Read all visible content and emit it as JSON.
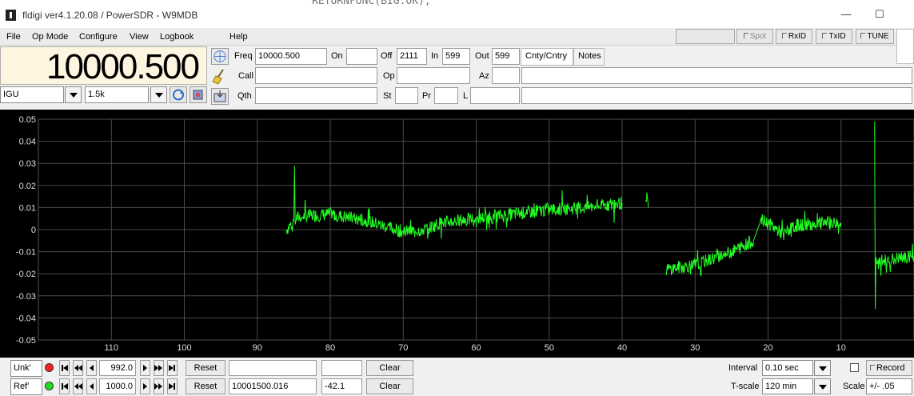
{
  "window": {
    "title": "fldigi ver4.1.20.08 / PowerSDR - W9MDB",
    "background_text": "RETURNFUNC(BIG.OK);",
    "minimize": "—",
    "maximize": "☐"
  },
  "menu": {
    "file": "File",
    "op_mode": "Op Mode",
    "configure": "Configure",
    "view": "View",
    "logbook": "Logbook",
    "help": "Help"
  },
  "toolbar": {
    "spot": "Spot",
    "rxid": "RxID",
    "txid": "TxID",
    "tune": "TUNE"
  },
  "freq_display": "10000.500",
  "mode": {
    "sideband": "IGU",
    "bandwidth": "1.5k"
  },
  "log": {
    "freq_label": "Freq",
    "freq_value": "10000.500",
    "on_label": "On",
    "on_value": "",
    "off_label": "Off",
    "off_value": "2111",
    "in_label": "In",
    "in_value": "599",
    "out_label": "Out",
    "out_value": "599",
    "tab_cnty": "Cnty/Cntry",
    "tab_notes": "Notes",
    "call_label": "Call",
    "call_value": "",
    "op_label": "Op",
    "op_value": "",
    "az_label": "Az",
    "az_value": "",
    "qth_label": "Qth",
    "qth_value": "",
    "st_label": "St",
    "st_value": "",
    "pr_label": "Pr",
    "pr_value": "",
    "l_label": "L",
    "l_value": ""
  },
  "chart_data": {
    "type": "line",
    "ylim": [
      -0.05,
      0.05
    ],
    "yticks": [
      "0.05",
      "0.04",
      "0.03",
      "0.02",
      "0.01",
      "0",
      "-0.01",
      "-0.02",
      "-0.03",
      "-0.04",
      "-0.05"
    ],
    "xlim": [
      120,
      0
    ],
    "xticks": [
      "110",
      "100",
      "90",
      "80",
      "70",
      "60",
      "50",
      "40",
      "30",
      "20",
      "10"
    ],
    "xtick_values": [
      110,
      100,
      90,
      80,
      70,
      60,
      50,
      40,
      30,
      20,
      10
    ],
    "grid": true,
    "line_color": "#22ff22",
    "grid_color": "#4a4a4a",
    "series": [
      {
        "x": [
          86,
          85,
          84.9,
          84.8,
          84,
          80,
          75,
          70,
          67,
          65,
          60,
          55,
          50,
          45,
          40
        ],
        "y": [
          0.0,
          0.004,
          0.029,
          0.005,
          0.006,
          0.007,
          0.004,
          -0.001,
          0.0,
          0.003,
          0.005,
          0.007,
          0.009,
          0.01,
          0.012
        ]
      },
      {
        "x": [
          36.8,
          36.6,
          36.4
        ],
        "y": [
          0.01,
          0.014,
          0.01
        ]
      },
      {
        "x": [
          34,
          30,
          25,
          22,
          21,
          20,
          18,
          16,
          12,
          10
        ],
        "y": [
          -0.018,
          -0.016,
          -0.01,
          -0.005,
          0.004,
          0.003,
          -0.002,
          0.002,
          0.003,
          0.003
        ]
      },
      {
        "x": [
          5.4,
          5.3,
          5.2,
          5.1,
          5,
          4,
          2,
          0
        ],
        "y": [
          0.049,
          -0.036,
          -0.015,
          -0.015,
          -0.016,
          -0.014,
          -0.013,
          -0.012
        ]
      }
    ]
  },
  "unk": {
    "label": "Unk'",
    "led_color": "#ff2020",
    "value": "992.0",
    "reset": "Reset",
    "field1": "",
    "field2": "",
    "clear": "Clear"
  },
  "ref": {
    "label": "Ref'",
    "led_color": "#20dd20",
    "value": "1000.0",
    "reset": "Reset",
    "field1": "10001500.016",
    "field2": "-42.1",
    "clear": "Clear"
  },
  "controls": {
    "interval_label": "Interval",
    "interval_value": "0.10 sec",
    "record": "Record",
    "tscale_label": "T-scale",
    "tscale_value": "120 min",
    "scale_label": "Scale",
    "scale_value": "+/- .05"
  }
}
